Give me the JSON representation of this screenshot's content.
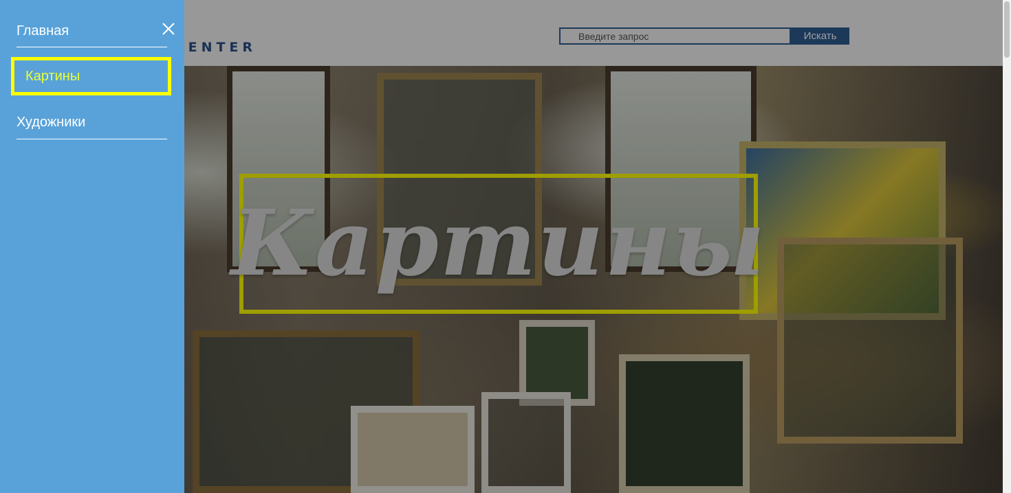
{
  "header": {
    "logo_text": "E ART CENTER",
    "search_placeholder": "Введите запрос",
    "search_button_label": "Искать"
  },
  "hero": {
    "title": "Картины"
  },
  "sidenav": {
    "items": [
      {
        "label": "Главная",
        "active": false
      },
      {
        "label": "Картины",
        "active": true
      },
      {
        "label": "Художники",
        "active": false
      }
    ]
  },
  "colors": {
    "sidenav_bg": "#59a2d9",
    "highlight": "#ffff00",
    "active_text": "#e8ff3a",
    "brand": "#2f5d92"
  },
  "icons": {
    "close": "close-icon"
  }
}
